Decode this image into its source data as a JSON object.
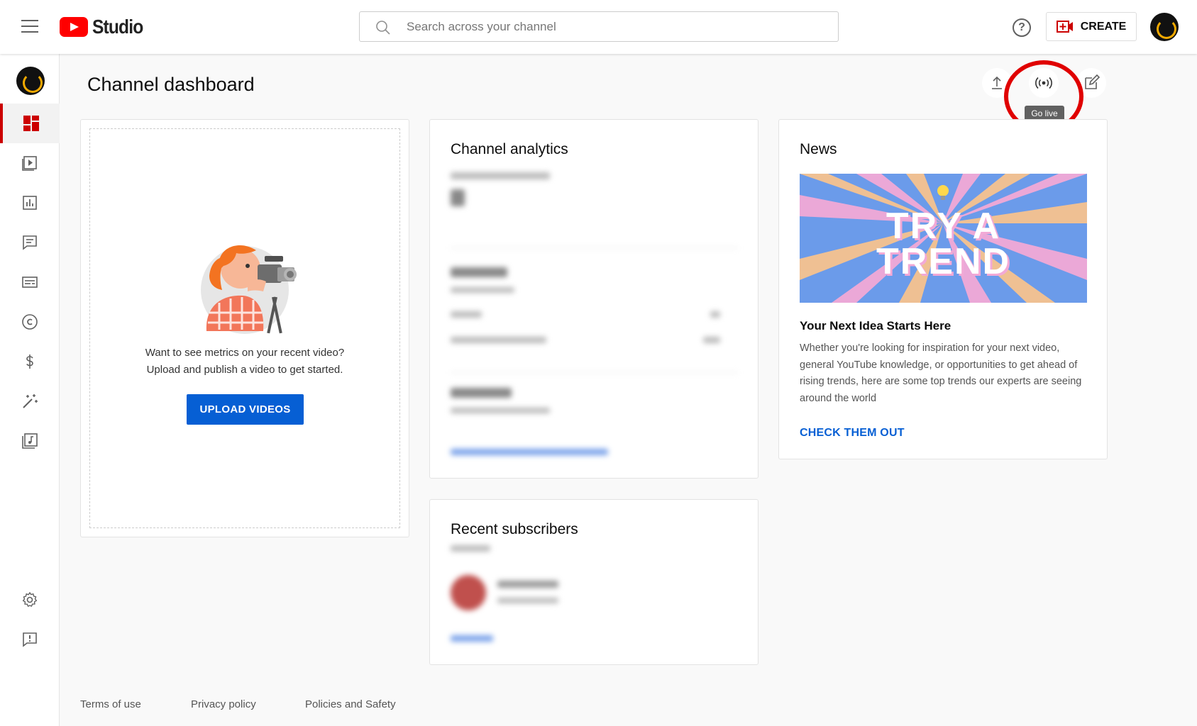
{
  "header": {
    "logo_text": "Studio",
    "search_placeholder": "Search across your channel",
    "help_label": "?",
    "create_label": "CREATE"
  },
  "page": {
    "title": "Channel dashboard",
    "tooltip": "Go live"
  },
  "upload_card": {
    "line1": "Want to see metrics on your recent video?",
    "line2": "Upload and publish a video to get started.",
    "button_label": "UPLOAD VIDEOS"
  },
  "analytics_card": {
    "title": "Channel analytics"
  },
  "news_card": {
    "title": "News",
    "banner_line1": "TRY A",
    "banner_line2": "TREND",
    "headline": "Your Next Idea Starts Here",
    "description": "Whether you're looking for inspiration for your next video, general YouTube knowledge, or opportunities to get ahead of rising trends, here are some top trends our experts are seeing around the world",
    "link_label": "CHECK THEM OUT"
  },
  "subscribers_card": {
    "title": "Recent subscribers"
  },
  "footer": {
    "terms": "Terms of use",
    "privacy": "Privacy policy",
    "policies": "Policies and Safety"
  },
  "colors": {
    "brand_red": "#ff0000",
    "link_blue": "#065fd4",
    "highlight_ring": "#e00000"
  }
}
